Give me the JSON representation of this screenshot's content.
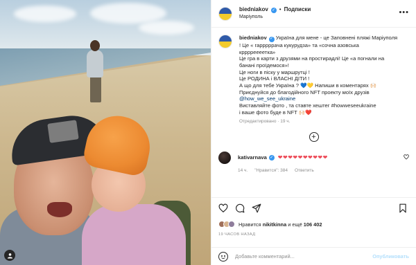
{
  "header": {
    "username": "biedniakov",
    "verified": true,
    "separator": "•",
    "follow_label": "Подписки",
    "location": "Маріуполь",
    "more_icon": "ellipsis-icon"
  },
  "caption": {
    "username": "biedniakov",
    "lines": [
      " Україна для мене - це Заповнені пляжі Маріуполя",
      "! Це « гарррррача кукурудза» та «сочна азовська",
      "крррреееетка»",
      "Це гра в карти з друзями на простирадлі! Це «а погнали на",
      "банані проїдемося»!",
      "Це ноги в піску у маршрутці !",
      "Це РОДИНА і ВЛАСНІ ДІТИ !",
      "А що для тебе Україна ? 💙💛  Напиши в коментарях 🙌🏻",
      "Приєднуйся до благодійного NFT проекту моїх друзів",
      "@how_we_see_ukraine",
      "Виставляйте фото , та ставте хештег #howweseeukraine",
      "і ваше фото буде в NFT 🙌🏻❤️"
    ],
    "meta": "Отредактировано · 19 ч."
  },
  "load_more_icon": "plus-circle-icon",
  "comment": {
    "username": "kativarnava",
    "verified": true,
    "text": "❤❤❤❤❤❤❤❤❤❤",
    "time": "14 ч.",
    "likes": "\"Нравится\": 384",
    "reply_label": "Ответить",
    "like_icon": "heart-outline-icon"
  },
  "actions": {
    "icons": [
      "heart-icon",
      "comment-icon",
      "share-icon",
      "bookmark-icon"
    ],
    "liked_by_prefix": "Нравится",
    "liked_by_user": "nikitkinna",
    "liked_by_suffix": "и ещё",
    "liked_by_count": "106 402",
    "posted_ago": "19 ЧАСОВ НАЗАД"
  },
  "add_comment": {
    "placeholder": "Добавьте комментарий...",
    "publish_label": "Опубликовать"
  },
  "colors": {
    "accent_blue": "#3897f0",
    "link_blue": "#00376b",
    "heart_red": "#ed4956",
    "muted_gray": "#8e8e8e",
    "publish_disabled": "#b2dffc"
  }
}
